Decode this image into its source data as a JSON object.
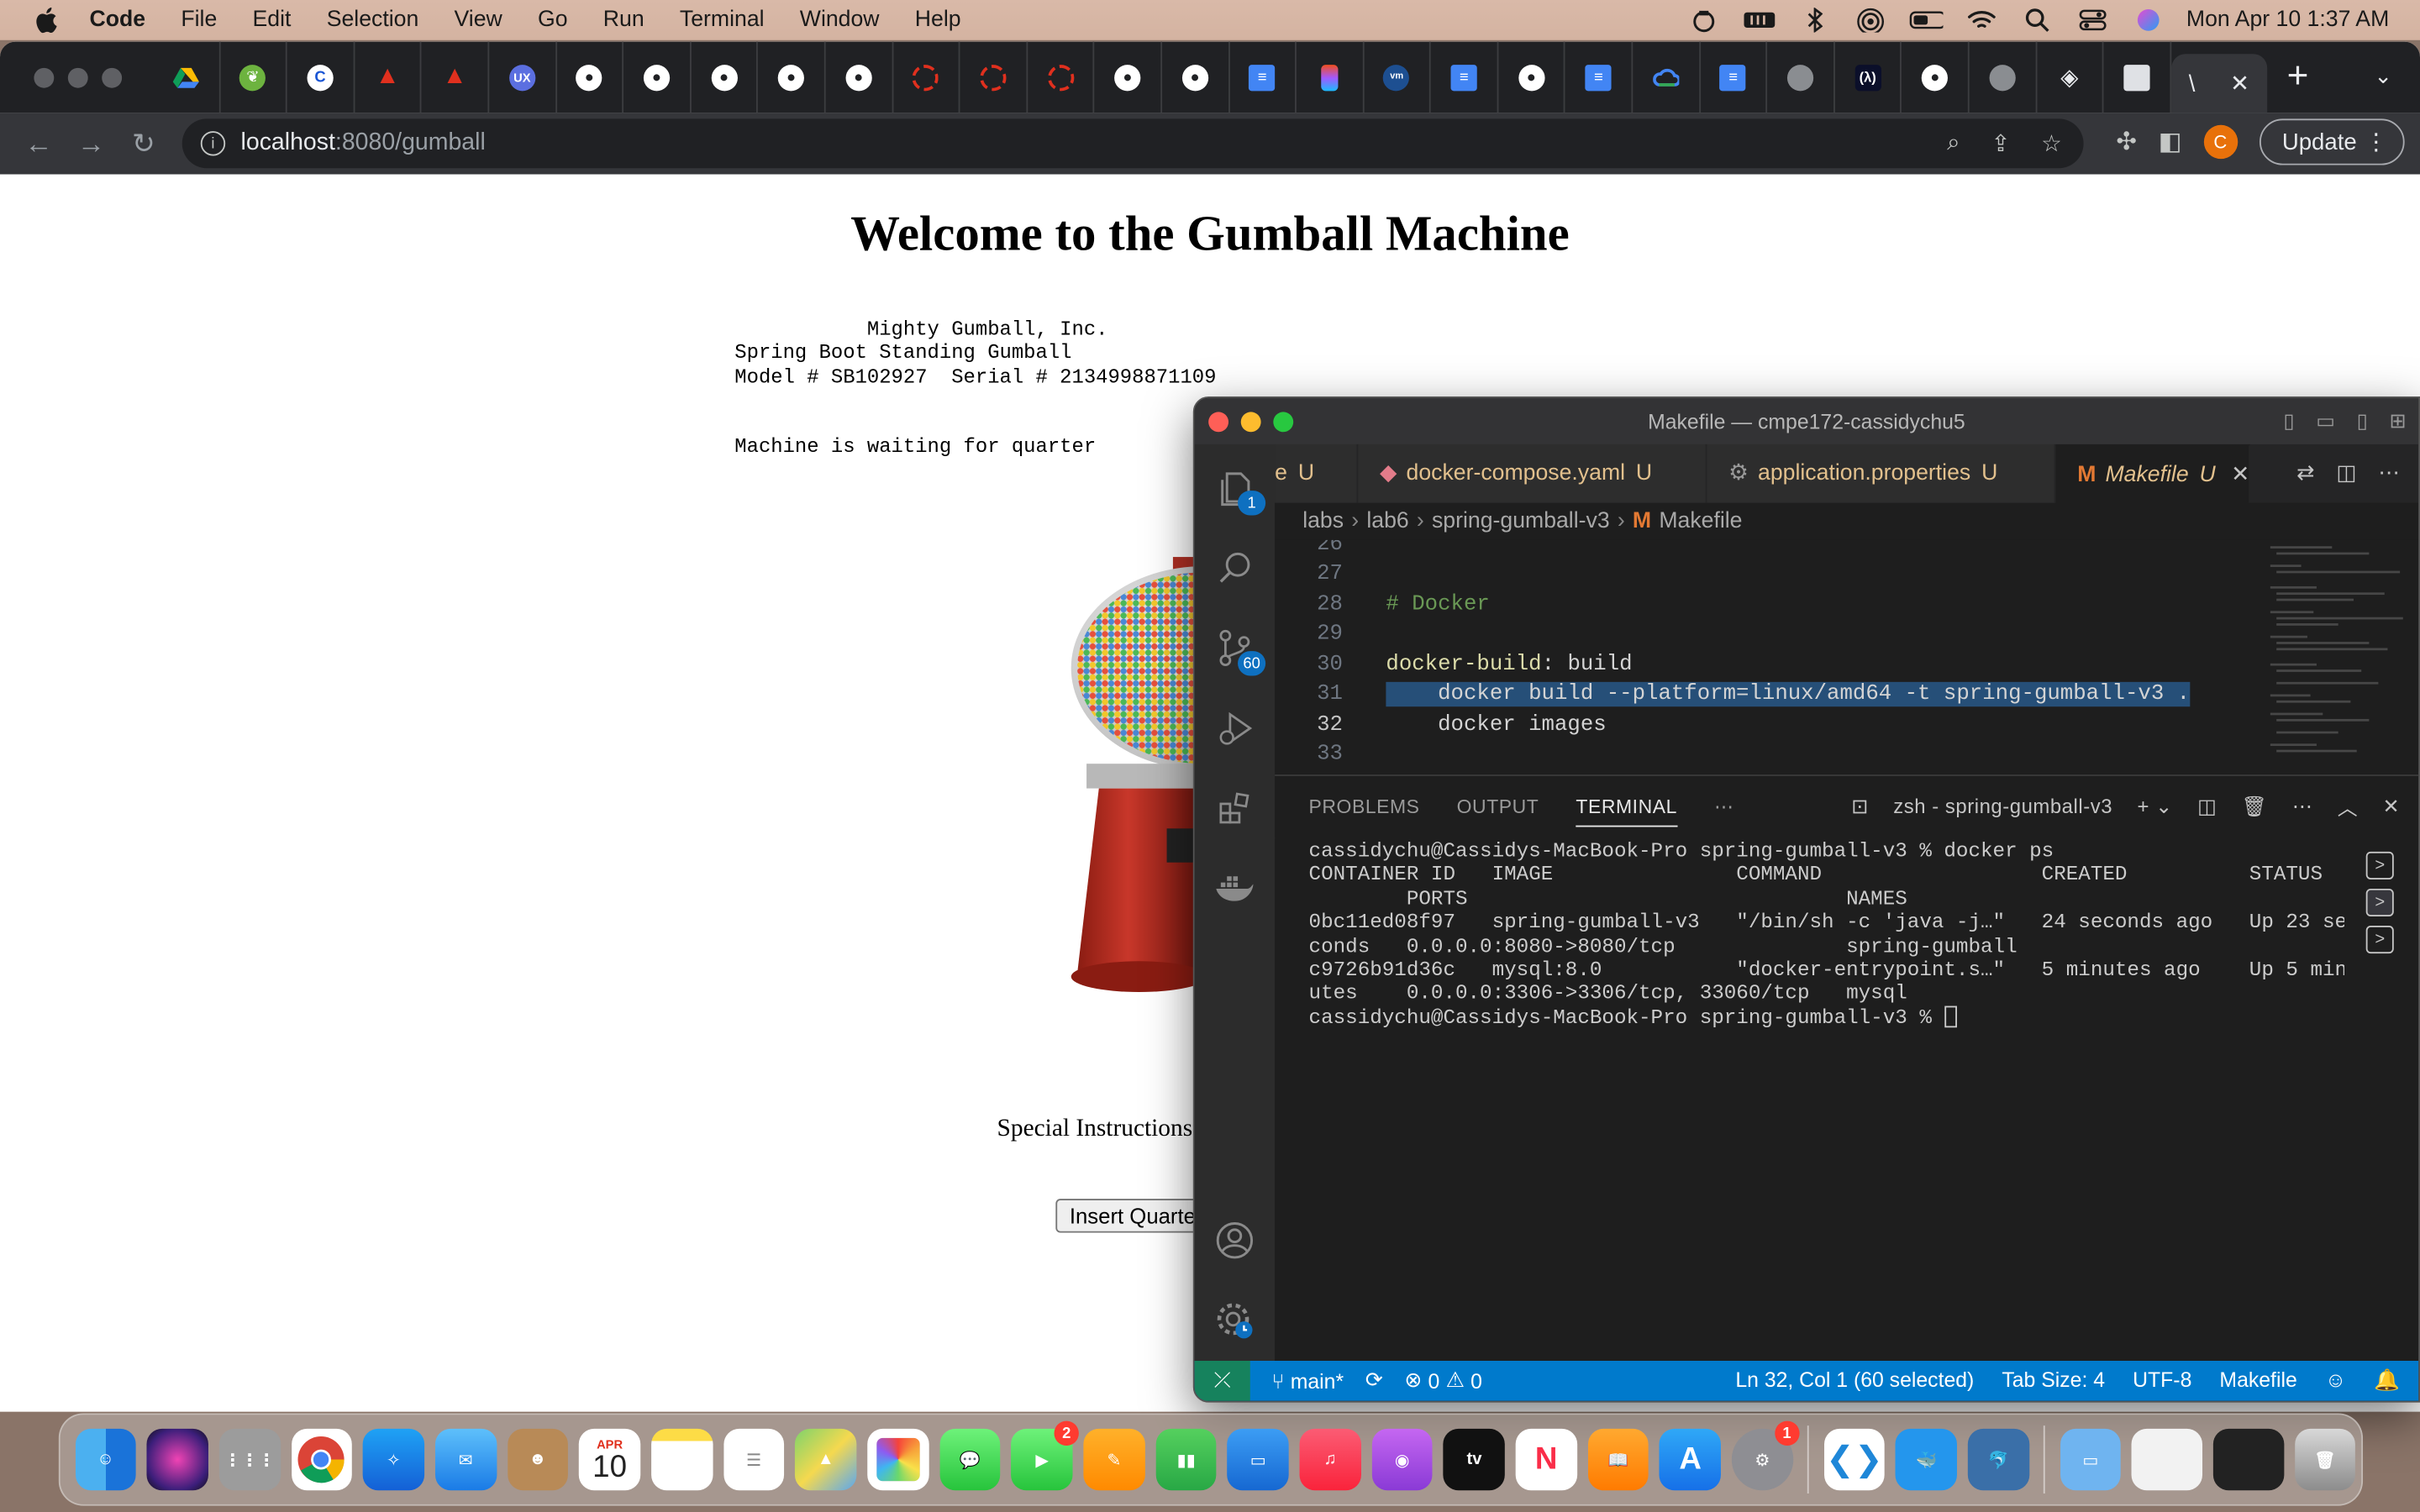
{
  "menubar": {
    "app": "Code",
    "items": [
      "File",
      "Edit",
      "Selection",
      "View",
      "Go",
      "Run",
      "Terminal",
      "Window",
      "Help"
    ],
    "clock": "Mon Apr 10  1:37 AM"
  },
  "browser": {
    "url_host": "localhost",
    "url_path": ":8080/gumball",
    "update_label": "Update",
    "profile_initial": "C",
    "active_tab_glyph": "\\"
  },
  "page": {
    "heading": "Welcome to the Gumball Machine",
    "company_block": "           Mighty Gumball, Inc.\nSpring Boot Standing Gumball\nModel # SB102927  Serial # 2134998871109",
    "status": "Machine is waiting for quarter",
    "special_label": "Special Instructions:",
    "insert_button": "Insert Quarter"
  },
  "vscode": {
    "title": "Makefile — cmpe172-cassidychu5",
    "tabs": [
      {
        "label": "e",
        "status": "U"
      },
      {
        "label": "docker-compose.yaml",
        "status": "U"
      },
      {
        "label": "application.properties",
        "status": "U"
      },
      {
        "label": "Makefile",
        "status": "U"
      }
    ],
    "breadcrumb": [
      "labs",
      "lab6",
      "spring-gumball-v3",
      "Makefile"
    ],
    "explorer_badge": "1",
    "scm_badge": "60",
    "code_lines": [
      {
        "num": "26",
        "text": ""
      },
      {
        "num": "27",
        "text": ""
      },
      {
        "num": "28",
        "text": "# Docker"
      },
      {
        "num": "29",
        "text": ""
      },
      {
        "num": "30",
        "text_target": "docker-build",
        "text_rest": ": build"
      },
      {
        "num": "31",
        "text": "    docker build --platform=linux/amd64 -t spring-gumball-v3 ."
      },
      {
        "num": "32",
        "text": "    docker images"
      },
      {
        "num": "33",
        "text": ""
      }
    ],
    "panel_tabs": [
      "PROBLEMS",
      "OUTPUT",
      "TERMINAL"
    ],
    "terminal_name": "zsh - spring-gumball-v3",
    "terminal_text": "cassidychu@Cassidys-MacBook-Pro spring-gumball-v3 % docker ps\nCONTAINER ID   IMAGE               COMMAND                  CREATED          STATUS\n        PORTS                               NAMES\n0bc11ed08f97   spring-gumball-v3   \"/bin/sh -c 'java -j…\"   24 seconds ago   Up 23 se\nconds   0.0.0.0:8080->8080/tcp              spring-gumball\nc9726b91d36c   mysql:8.0           \"docker-entrypoint.s…\"   5 minutes ago    Up 5 min\nutes    0.0.0.0:3306->3306/tcp, 33060/tcp   mysql\ncassidychu@Cassidys-MacBook-Pro spring-gumball-v3 % ",
    "status": {
      "branch": "main*",
      "problems": "0",
      "warnings": "0",
      "cursor": "Ln 32, Col 1 (60 selected)",
      "tabsize": "Tab Size: 4",
      "encoding": "UTF-8",
      "language": "Makefile"
    }
  },
  "dock": {
    "calendar_month": "APR",
    "calendar_day": "10",
    "facetime_badge": "2",
    "settings_badge": "1",
    "tv_label": "tv"
  }
}
